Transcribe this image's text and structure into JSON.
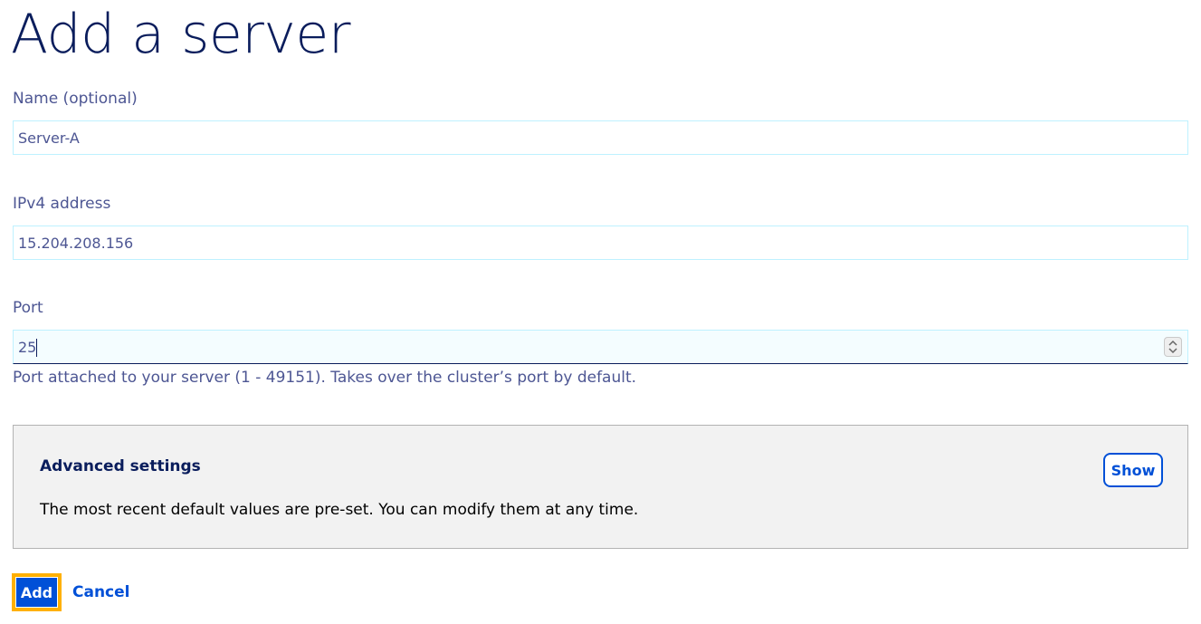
{
  "page": {
    "title": "Add a server"
  },
  "form": {
    "name": {
      "label": "Name (optional)",
      "value": "Server-A"
    },
    "ipv4": {
      "label": "IPv4 address",
      "value": "15.204.208.156"
    },
    "port": {
      "label": "Port",
      "value": "25",
      "help": "Port attached to your server (1 - 49151). Takes over the cluster’s port by default."
    }
  },
  "advanced": {
    "title": "Advanced settings",
    "description": "The most recent default values are pre-set. You can modify them at any time.",
    "show_label": "Show"
  },
  "actions": {
    "add_label": "Add",
    "cancel_label": "Cancel"
  },
  "colors": {
    "title": "#0a1d5c",
    "text": "#4d5693",
    "primary": "#0050d7",
    "focus_ring": "#ffb000",
    "input_border": "#bef1ff",
    "panel_bg": "#f2f2f2"
  },
  "icons": {
    "port_spinner": "spinner-arrows-icon"
  }
}
